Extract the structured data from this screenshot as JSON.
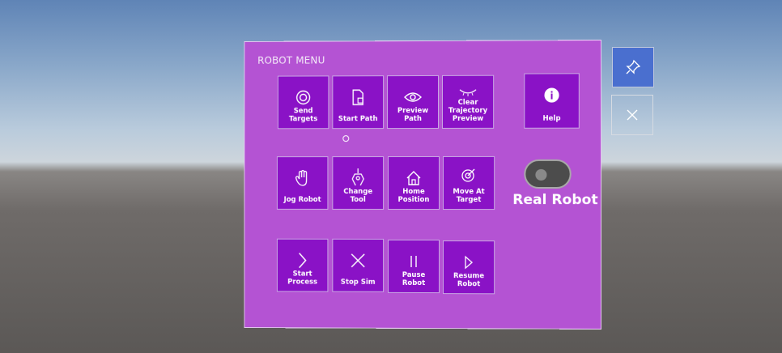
{
  "panel": {
    "title": "ROBOT MENU"
  },
  "tiles": {
    "send_targets": "Send Targets",
    "start_path": "Start Path",
    "preview_path": "Preview Path",
    "clear_trajectory": "Clear Trajectory Preview",
    "jog_robot": "Jog Robot",
    "change_tool": "Change Tool",
    "home_position": "Home Position",
    "move_at_target": "Move At Target",
    "start_process": "Start Process",
    "stop_sim": "Stop Sim",
    "pause_robot": "Pause Robot",
    "resume_robot": "Resume Robot",
    "help": "Help"
  },
  "toggle": {
    "label": "Real Robot",
    "state": "off"
  },
  "side": {
    "pin_icon": "pin-icon",
    "close_icon": "close-icon"
  },
  "colors": {
    "panel": "#b453d3",
    "tile": "#8a12c6",
    "pin_button": "#4a6fcf"
  }
}
